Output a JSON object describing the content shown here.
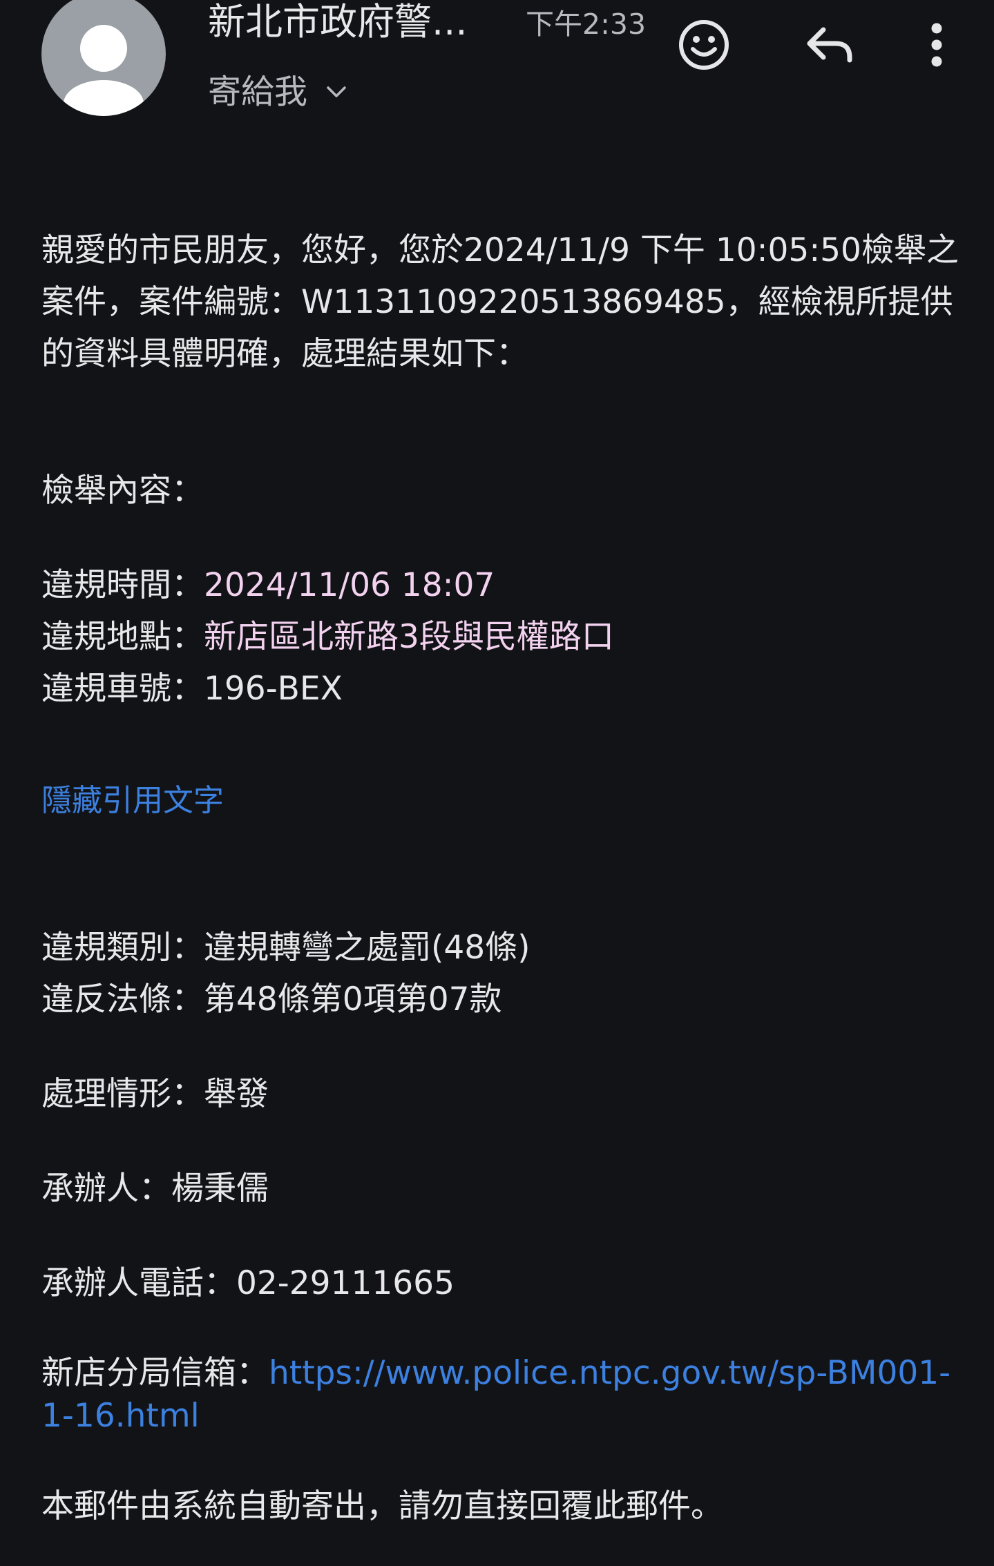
{
  "header": {
    "sender": "新北市政府警...",
    "time": "下午2:33",
    "recipient": "寄給我",
    "icons": {
      "avatar": "person-avatar",
      "emoji": "emoji-icon",
      "reply": "reply-icon",
      "more": "more-vert-icon",
      "chevron": "chevron-down-icon"
    }
  },
  "email": {
    "intro": "親愛的市民朋友，您好，您於2024/11/9 下午 10:05:50檢舉之案件，案件編號：W1131109220513869485，經檢視所提供的資料具體明確，處理結果如下：",
    "report_title": "檢舉內容：",
    "violation_time_label": "違規時間：",
    "violation_time_value": "2024/11/06 18:07",
    "violation_place_label": "違規地點：",
    "violation_place_value": "新店區北新路3段與民權路口",
    "plate_label": "違規車號：",
    "plate_value": "196-BEX",
    "hide_quoted": "隱藏引用文字",
    "category_label": "違規類別：",
    "category_value": "違規轉彎之處罰(48條)",
    "law_label": "違反法條：",
    "law_value": "第48條第0項第07款",
    "status_label": "處理情形：",
    "status_value": "舉發",
    "handler_label": "承辦人：",
    "handler_value": "楊秉儒",
    "phone_label": "承辦人電話：",
    "phone_value": "02-29111665",
    "mailbox_label": "新店分局信箱：",
    "mailbox_url": "https://www.police.ntpc.gov.tw/sp-BM001-1-16.html",
    "footer": "本郵件由系統自動寄出，請勿直接回覆此郵件。"
  },
  "colors": {
    "background": "#121317",
    "text": "#e8e8ea",
    "secondary": "#b7b9be",
    "link": "#3c80e0",
    "highlight": "#f3d2ef",
    "avatar": "#9aa0a6"
  }
}
